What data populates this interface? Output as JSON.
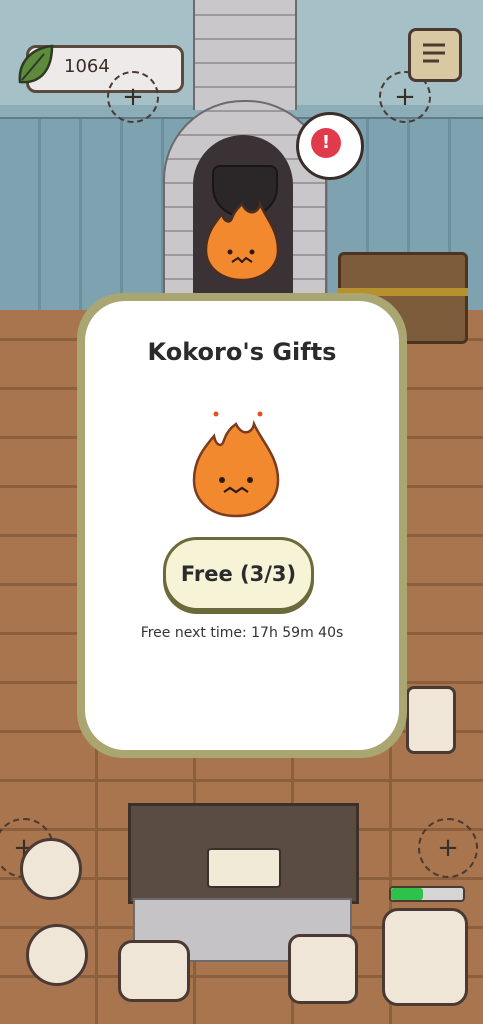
{
  "hud": {
    "leaf_count": "1064",
    "menu_icon": "notebook-icon",
    "alert_icon": "exclamation-icon"
  },
  "modal": {
    "title": "Kokoro's Gifts",
    "button_label": "Free (3/3)",
    "next_free_text": "Free next time: 17h 59m 40s",
    "mascot_icon": "fire-spirit-icon"
  },
  "status": {
    "progress_fraction": 0.45
  },
  "colors": {
    "accent_green": "#2ec24a",
    "modal_border": "#a9a672",
    "alert_red": "#e03a4b",
    "fire_orange": "#f2892f"
  }
}
